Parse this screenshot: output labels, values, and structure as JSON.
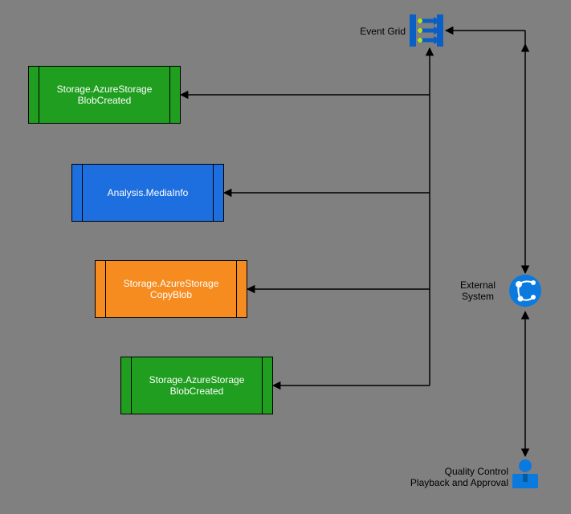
{
  "labels": {
    "eventGrid": "Event Grid",
    "externalSystem": "External\nSystem",
    "qualityControl": "Quality Control\nPlayback and Approval"
  },
  "nodes": {
    "blobCreated1": "Storage.AzureStorage\nBlobCreated",
    "mediaInfo": "Analysis.MediaInfo",
    "copyBlob": "Storage.AzureStorage\nCopyBlob",
    "blobCreated2": "Storage.AzureStorage\nBlobCreated"
  },
  "icons": {
    "eventGrid": "event-grid-icon",
    "externalSystem": "logic-apps-icon",
    "user": "user-icon"
  },
  "chart_data": {
    "type": "diagram",
    "title": "",
    "nodes": [
      {
        "id": "eventGrid",
        "label": "Event Grid",
        "kind": "service-icon"
      },
      {
        "id": "externalSystem",
        "label": "External System",
        "kind": "service-icon"
      },
      {
        "id": "qualityControl",
        "label": "Quality Control Playback and Approval",
        "kind": "actor"
      },
      {
        "id": "blobCreated1",
        "label": "Storage.AzureStorage BlobCreated",
        "kind": "event",
        "color": "green"
      },
      {
        "id": "mediaInfo",
        "label": "Analysis.MediaInfo",
        "kind": "event",
        "color": "blue"
      },
      {
        "id": "copyBlob",
        "label": "Storage.AzureStorage CopyBlob",
        "kind": "event",
        "color": "orange"
      },
      {
        "id": "blobCreated2",
        "label": "Storage.AzureStorage BlobCreated",
        "kind": "event",
        "color": "green"
      }
    ],
    "edges": [
      {
        "from": "eventGrid",
        "to": "blobCreated1",
        "dir": "both"
      },
      {
        "from": "eventGrid",
        "to": "mediaInfo",
        "dir": "both"
      },
      {
        "from": "eventGrid",
        "to": "copyBlob",
        "dir": "both"
      },
      {
        "from": "eventGrid",
        "to": "blobCreated2",
        "dir": "both"
      },
      {
        "from": "externalSystem",
        "to": "eventGrid",
        "dir": "both"
      },
      {
        "from": "externalSystem",
        "to": "qualityControl",
        "dir": "both"
      }
    ]
  }
}
